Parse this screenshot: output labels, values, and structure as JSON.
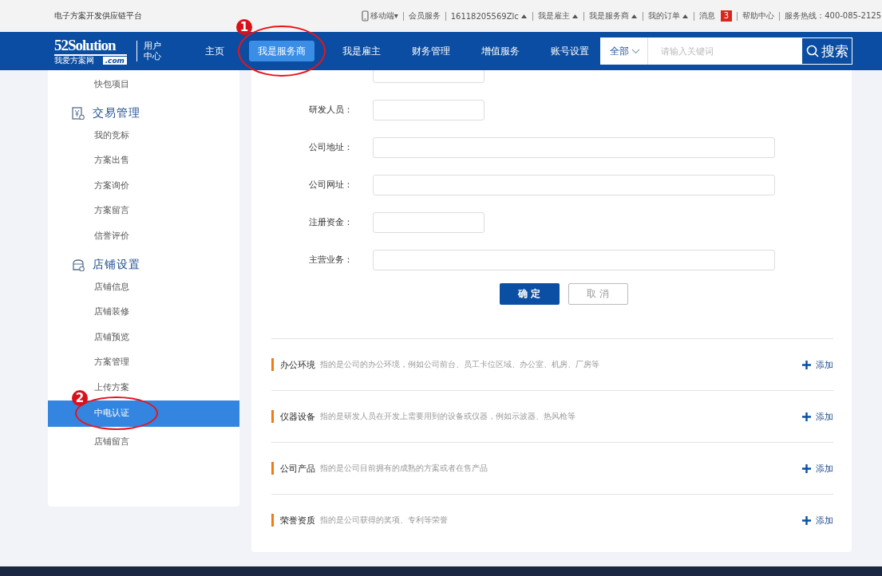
{
  "top_bar": {
    "site_name": "电子方案开发供应链平台",
    "links": [
      {
        "kind": "mobile",
        "label": "移动端▾"
      },
      {
        "kind": "plain",
        "label": "会员服务"
      },
      {
        "kind": "menu",
        "label": "16118205569Zlc"
      },
      {
        "kind": "menu",
        "label": "我是雇主"
      },
      {
        "kind": "menu",
        "label": "我是服务商"
      },
      {
        "kind": "menu",
        "label": "我的订单"
      },
      {
        "kind": "badge",
        "label": "消息",
        "badge": "3"
      },
      {
        "kind": "plain",
        "label": "帮助中心"
      },
      {
        "kind": "plain",
        "label": "服务热线：400-085-2125"
      }
    ]
  },
  "nav": {
    "logo": {
      "main": "52Solution",
      "sub": "我爱方案网",
      "domain": ".com"
    },
    "center": [
      "用户",
      "中心"
    ],
    "items": [
      {
        "label": "主页",
        "selected": false
      },
      {
        "label": "我是服务商",
        "selected": true
      },
      {
        "label": "我是雇主",
        "selected": false
      },
      {
        "label": "财务管理",
        "selected": false
      },
      {
        "label": "增值服务",
        "selected": false
      },
      {
        "label": "账号设置",
        "selected": false
      }
    ],
    "search": {
      "scope": "全部",
      "placeholder": "请输入关键词",
      "button": "搜索"
    }
  },
  "sidebar": {
    "groups": [
      {
        "items": [
          {
            "label": "快包项目",
            "selected": false
          }
        ]
      },
      {
        "title": "交易管理",
        "items": [
          {
            "label": "我的竞标",
            "selected": false
          },
          {
            "label": "方案出售",
            "selected": false
          },
          {
            "label": "方案询价",
            "selected": false
          },
          {
            "label": "方案留言",
            "selected": false
          },
          {
            "label": "信誉评价",
            "selected": false
          }
        ]
      },
      {
        "title": "店铺设置",
        "items": [
          {
            "label": "店铺信息",
            "selected": false
          },
          {
            "label": "店铺装修",
            "selected": false
          },
          {
            "label": "店铺预览",
            "selected": false
          },
          {
            "label": "方案管理",
            "selected": false
          },
          {
            "label": "上传方案",
            "selected": false
          },
          {
            "label": "中电认证",
            "selected": true
          },
          {
            "label": "店铺留言",
            "selected": false
          }
        ]
      }
    ]
  },
  "form": {
    "fields": [
      {
        "kind": "short"
      },
      {
        "label": "研发人员：",
        "kind": "short"
      },
      {
        "label": "公司地址：",
        "kind": "long"
      },
      {
        "label": "公司网址：",
        "kind": "long"
      },
      {
        "label": "注册资金：",
        "kind": "short"
      },
      {
        "label": "主营业务：",
        "kind": "long"
      }
    ],
    "confirm": "确 定",
    "cancel": "取 消"
  },
  "sections": [
    {
      "title": "办公环境",
      "description": "指的是公司的办公环境，例如公司前台、员工卡位区域、办公室、机房、厂房等",
      "action": "添加"
    },
    {
      "title": "仪器设备",
      "description": "指的是研发人员在开发上需要用到的设备或仪器，例如示波器、热风枪等",
      "action": "添加"
    },
    {
      "title": "公司产品",
      "description": "指的是公司目前拥有的成熟的方案或者在售产品",
      "action": "添加"
    },
    {
      "title": "荣誉资质",
      "description": "指的是公司获得的奖项、专利等荣誉",
      "action": "添加"
    }
  ],
  "annotations": [
    {
      "number": "1"
    },
    {
      "number": "2"
    }
  ]
}
